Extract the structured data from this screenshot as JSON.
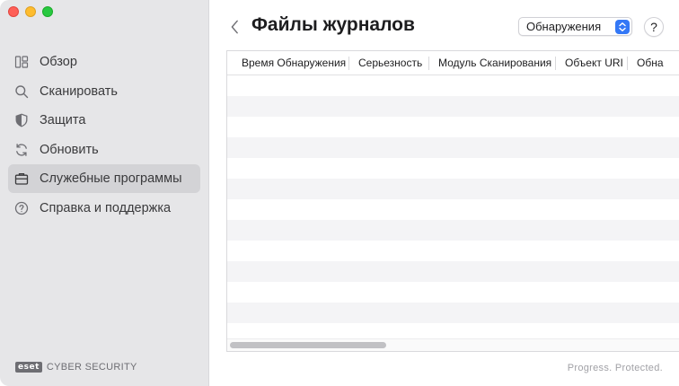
{
  "sidebar": {
    "items": [
      {
        "label": "Обзор",
        "icon": "dashboard-icon",
        "active": false
      },
      {
        "label": "Сканировать",
        "icon": "search-icon",
        "active": false
      },
      {
        "label": "Защита",
        "icon": "shield-icon",
        "active": false
      },
      {
        "label": "Обновить",
        "icon": "refresh-icon",
        "active": false
      },
      {
        "label": "Служебные программы",
        "icon": "briefcase-icon",
        "active": true
      },
      {
        "label": "Справка и поддержка",
        "icon": "help-circle-icon",
        "active": false
      }
    ],
    "brand_logo": "eset",
    "brand_text": "CYBER SECURITY"
  },
  "header": {
    "title": "Файлы журналов",
    "select_value": "Обнаружения",
    "help_label": "?"
  },
  "table": {
    "columns": [
      "Время Обнаружения",
      "Серьезность",
      "Модуль Сканирования",
      "Объект URI",
      "Обна"
    ],
    "rows": []
  },
  "footer": {
    "tagline": "Progress. Protected."
  },
  "colors": {
    "sidebar_bg": "#e6e6e8",
    "active_item_bg": "#d3d3d6",
    "accent": "#3478f6"
  }
}
